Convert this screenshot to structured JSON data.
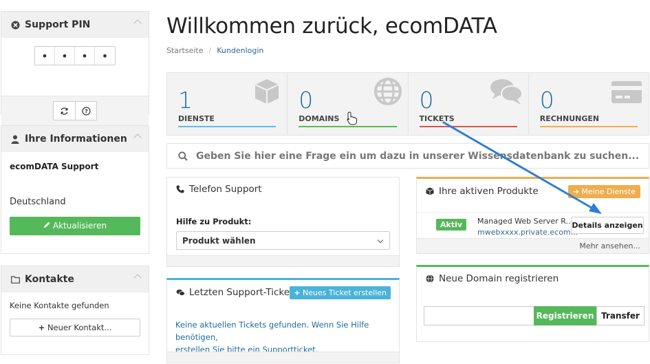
{
  "sidebar": {
    "pin": {
      "title": "Support PIN",
      "digits": [
        "•",
        "•",
        "•",
        "•"
      ]
    },
    "info": {
      "title": "Ihre Informationen",
      "name": "ecomDATA Support",
      "country": "Deutschland",
      "update_button": "Aktualisieren"
    },
    "contacts": {
      "title": "Kontakte",
      "empty_text": "Keine Kontakte gefunden",
      "new_button": "Neuer Kontakt..."
    }
  },
  "header": {
    "title": "Willkommen zurück, ecomDATA",
    "breadcrumb": [
      "Startseite",
      "Kundenlogin"
    ]
  },
  "stats": [
    {
      "value": "1",
      "label": "DIENSTE",
      "color": "#5bc0de",
      "icon": "cube-icon"
    },
    {
      "value": "0",
      "label": "DOMAINS",
      "color": "#5cb85c",
      "icon": "globe-icon"
    },
    {
      "value": "0",
      "label": "TICKETS",
      "color": "#d9534f",
      "icon": "comments-icon"
    },
    {
      "value": "0",
      "label": "RECHNUNGEN",
      "color": "#f0ad4e",
      "icon": "credit-card-icon"
    }
  ],
  "search": {
    "placeholder": "Geben Sie hier eine Frage ein um dazu in unserer Wissensdatenbank zu suchen..."
  },
  "phone_support": {
    "title": "Telefon Support",
    "field_label": "Hilfe zu Produkt:",
    "select_value": "Produkt wählen"
  },
  "products": {
    "title": "Ihre aktiven Produkte",
    "header_button": "Meine Dienste",
    "items": [
      {
        "status": "Aktiv",
        "name": "Managed Web Server R...",
        "host": "mwebxxxx.private.ecom...",
        "details_button": "Details anzeigen"
      }
    ],
    "more_link": "Mehr ansehen..."
  },
  "tickets": {
    "title": "Letzten Support-Tickets",
    "new_button": "Neues Ticket erstellen",
    "empty_text_1": "Keine aktuellen Tickets gefunden. Wenn Sie Hilfe benötigen,",
    "empty_text_2": "erstellen Sie bitte ",
    "empty_link": "ein Supportticket",
    "empty_text_3": "."
  },
  "domain": {
    "title": "Neue Domain registrieren",
    "register_button": "Registrieren",
    "transfer_button": "Transfer"
  },
  "colors": {
    "accent_blue": "#1f6c9e",
    "green": "#55b85a",
    "orange": "#f0ad4e",
    "light_blue": "#4ab3d7",
    "arrow": "#2f7fd0"
  }
}
